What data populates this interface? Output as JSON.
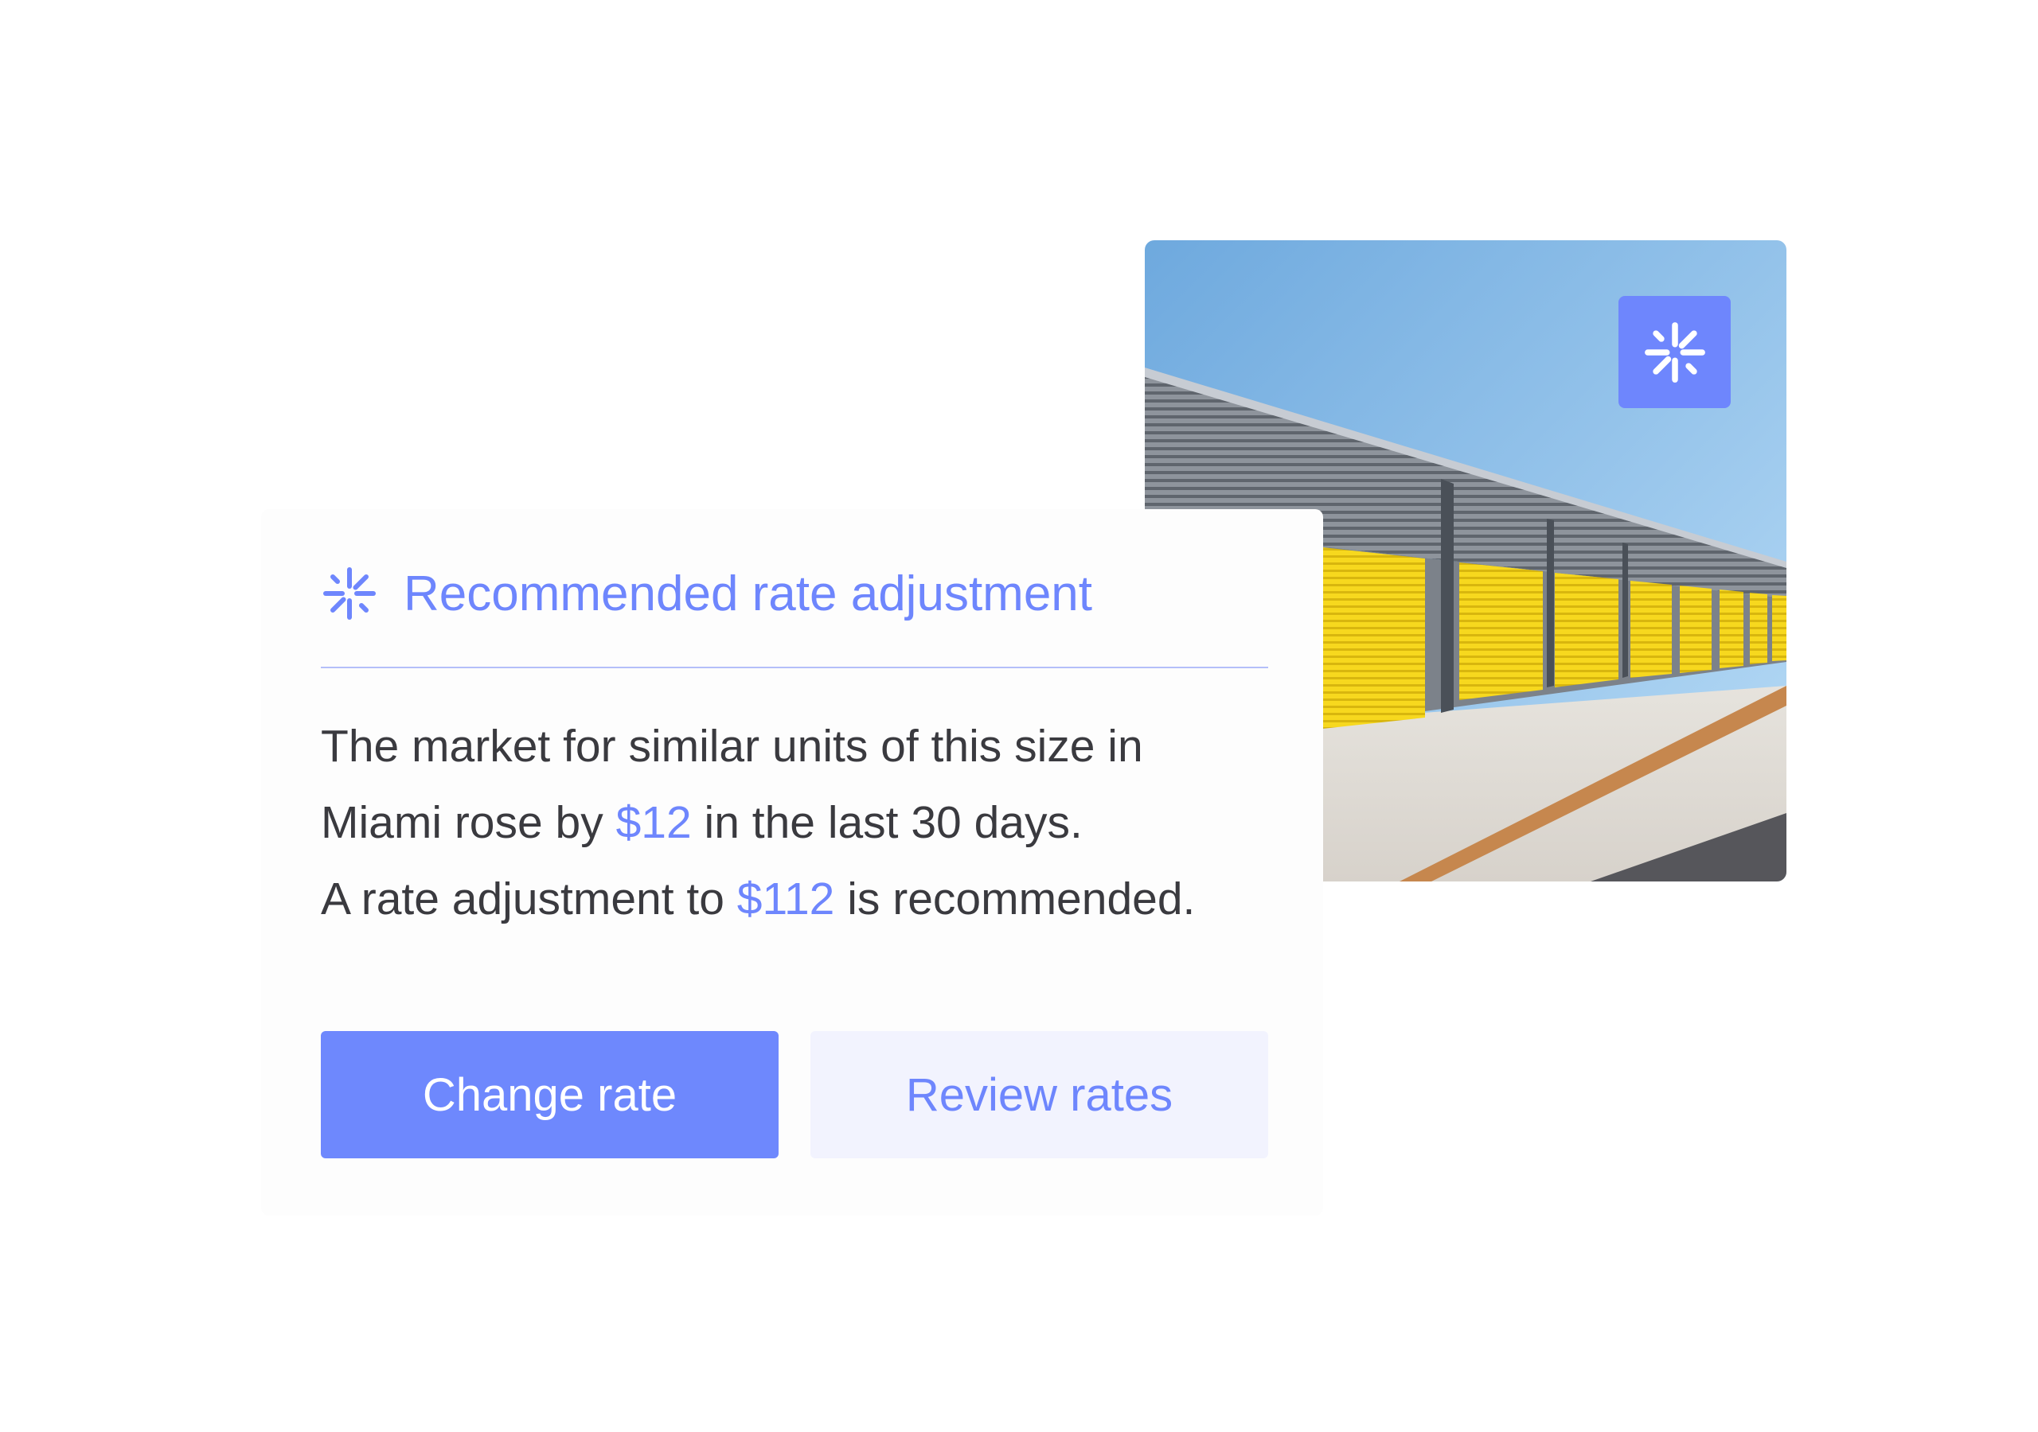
{
  "photo": {
    "alt": "Self-storage units with yellow roll-up doors",
    "badge_icon": "sparkle-icon"
  },
  "card": {
    "icon": "sparkle-icon",
    "title": "Recommended rate adjustment",
    "body": {
      "line1": "The market for similar units of this size in",
      "line2_before": "Miami rose by ",
      "line2_amount": "$12",
      "line2_after": " in the last 30 days.",
      "line3_before": "A rate adjustment to ",
      "line3_amount": "$112",
      "line3_after": " is recommended."
    },
    "primary_button": "Change rate",
    "secondary_button": "Review rates"
  },
  "colors": {
    "accent": "#6e86fd",
    "secondary_button_bg": "#f2f3fe",
    "body_text": "#3a3a3f",
    "door_yellow": "#f7d81e"
  }
}
